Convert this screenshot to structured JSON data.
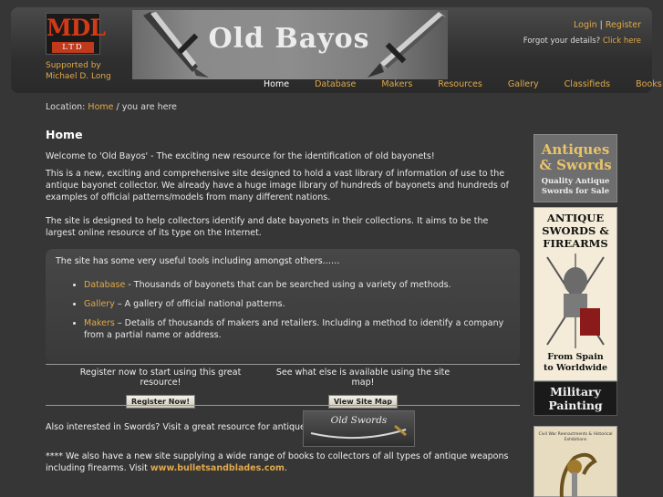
{
  "brand": {
    "logo_main": "MDL",
    "logo_sub": "LTD",
    "supported_by": "Supported by",
    "supporter": "Michael D. Long",
    "banner_title": "Old Bayos"
  },
  "auth": {
    "login": "Login",
    "separator": "|",
    "register": "Register",
    "forgot_text": "Forgot your details?",
    "forgot_link": "Click here"
  },
  "nav": {
    "items": [
      {
        "label": "Home"
      },
      {
        "label": "Database"
      },
      {
        "label": "Makers"
      },
      {
        "label": "Resources"
      },
      {
        "label": "Gallery"
      },
      {
        "label": "Classifieds"
      },
      {
        "label": "Books"
      }
    ]
  },
  "location": {
    "prefix": "Location:",
    "home_link": "Home",
    "rest": "/ you are here"
  },
  "main": {
    "heading": "Home",
    "p1": "Welcome to 'Old Bayos' - The exciting new resource for the identification of old bayonets!",
    "p2": "This is a new, exciting and comprehensive site designed to hold a vast library of information of use to the antique bayonet collector. We already have a huge image library of hundreds of bayonets and hundreds of examples of official patterns/models from many different nations.",
    "p3": "The site is designed to help collectors identify and date bayonets in their collections. It aims to be the largest online resource of its type on the Internet."
  },
  "tools": {
    "intro": "The site has some very useful tools including amongst others……",
    "items": [
      {
        "link": "Database",
        "text": " - Thousands of bayonets that can be searched using a variety of methods."
      },
      {
        "link": "Gallery",
        "text": " – A gallery of official national patterns."
      },
      {
        "link": "Makers",
        "text": " – Details of thousands of makers and retailers. Including a method to identify a company from a partial name or address."
      }
    ]
  },
  "cta": {
    "register_text": "Register now to start using this great resource!",
    "register_button": "Register Now!",
    "sitemap_text": "See what else is available using the site map!",
    "sitemap_button": "View Site Map"
  },
  "swords": {
    "text": "Also interested in Swords? Visit a great resource for antique swords",
    "image_caption": "Old Swords"
  },
  "books": {
    "text": "**** We also have a new site supplying a wide range of books to collectors of all types of antique weapons including firearms. Visit ",
    "link": "www.bulletsandblades.com",
    "end": "."
  },
  "ads": {
    "ad1_line1": "Antiques",
    "ad1_line2": "& Swords",
    "ad1_line3": "Quality Antique",
    "ad1_line4": "Swords for Sale",
    "ad2_line1": "ANTIQUE",
    "ad2_line2": "SWORDS &",
    "ad2_line3": "FIREARMS",
    "ad2_line4": "From Spain",
    "ad2_line5": "to Worldwide",
    "ad3_line1": "Military",
    "ad3_line2": "Painting",
    "ad4_text": "Civil War Reenactments & Historical Exhibitions"
  },
  "colors": {
    "background": "#363636",
    "link": "#e0a94a",
    "logo_red": "#d33a17"
  }
}
